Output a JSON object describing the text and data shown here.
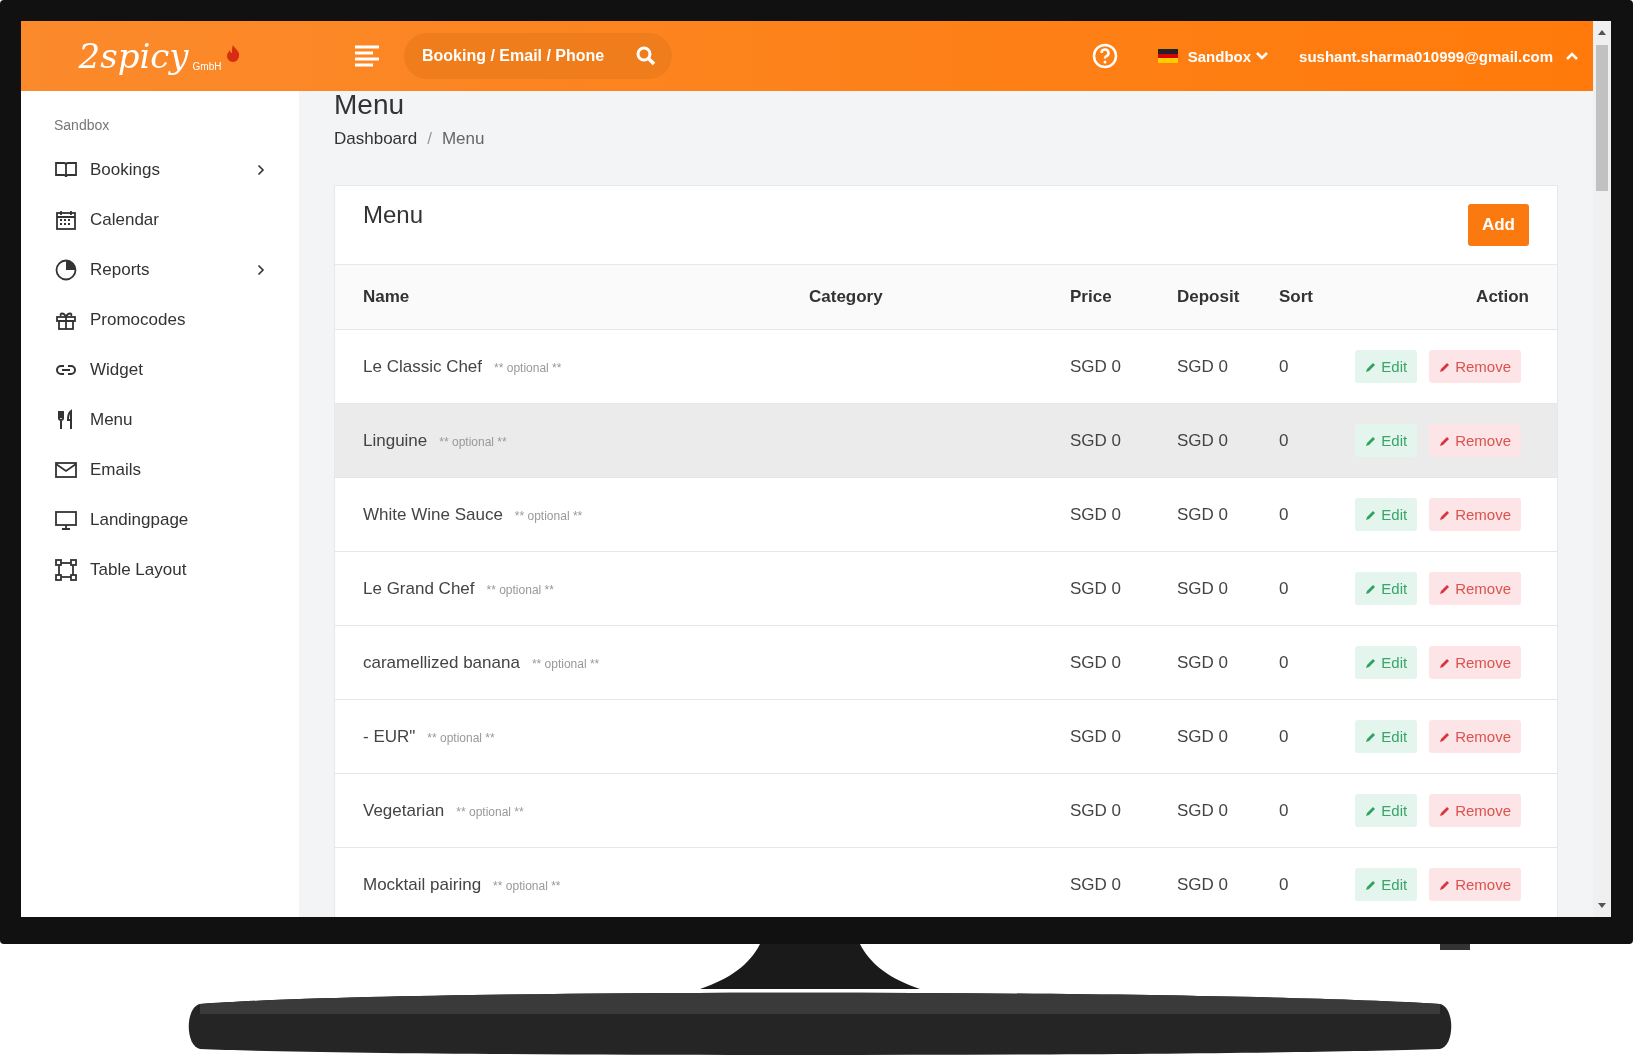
{
  "header": {
    "logo": "2spicy",
    "logo_sub": "GmbH",
    "search": {
      "placeholder": "Booking / Email / Phone"
    },
    "workspace": "Sandbox",
    "user": "sushant.sharma010999@gmail.com"
  },
  "sidebar": {
    "section": "Sandbox",
    "items": [
      {
        "label": "Bookings",
        "kind": "book",
        "has_submenu": true
      },
      {
        "label": "Calendar",
        "kind": "calendar",
        "has_submenu": false
      },
      {
        "label": "Reports",
        "kind": "pie",
        "has_submenu": true
      },
      {
        "label": "Promocodes",
        "kind": "gift",
        "has_submenu": false
      },
      {
        "label": "Widget",
        "kind": "link",
        "has_submenu": false
      },
      {
        "label": "Menu",
        "kind": "cutlery",
        "has_submenu": false
      },
      {
        "label": "Emails",
        "kind": "mail",
        "has_submenu": false
      },
      {
        "label": "Landingpage",
        "kind": "monitor",
        "has_submenu": false
      },
      {
        "label": "Table Layout",
        "kind": "layout",
        "has_submenu": false
      }
    ]
  },
  "page": {
    "title": "Menu",
    "breadcrumb": [
      "Dashboard",
      "Menu"
    ],
    "breadcrumb_separator": "/"
  },
  "card": {
    "title": "Menu",
    "add_button": "Add",
    "columns": [
      "Name",
      "Category",
      "Price",
      "Deposit",
      "Sort",
      "Action"
    ],
    "rows": [
      {
        "name": "Le Classic Chef",
        "note": "** optional **",
        "price": "SGD 0",
        "deposit": "SGD 0",
        "sort": "0",
        "edit": "Edit",
        "remove": "Remove",
        "hovered": false
      },
      {
        "name": "Linguine",
        "note": "** optional **",
        "price": "SGD 0",
        "deposit": "SGD 0",
        "sort": "0",
        "edit": "Edit",
        "remove": "Remove",
        "hovered": true
      },
      {
        "name": "White Wine Sauce",
        "note": "** optional **",
        "price": "SGD 0",
        "deposit": "SGD 0",
        "sort": "0",
        "edit": "Edit",
        "remove": "Remove",
        "hovered": false
      },
      {
        "name": "Le Grand Chef",
        "note": "** optional **",
        "price": "SGD 0",
        "deposit": "SGD 0",
        "sort": "0",
        "edit": "Edit",
        "remove": "Remove",
        "hovered": false
      },
      {
        "name": "caramellized banana",
        "note": "** optional **",
        "price": "SGD 0",
        "deposit": "SGD 0",
        "sort": "0",
        "edit": "Edit",
        "remove": "Remove",
        "hovered": false
      },
      {
        "name": "- EUR\"",
        "note": "** optional **",
        "price": "SGD 0",
        "deposit": "SGD 0",
        "sort": "0",
        "edit": "Edit",
        "remove": "Remove",
        "hovered": false
      },
      {
        "name": "Vegetarian",
        "note": "** optional **",
        "price": "SGD 0",
        "deposit": "SGD 0",
        "sort": "0",
        "edit": "Edit",
        "remove": "Remove",
        "hovered": false
      },
      {
        "name": "Mocktail pairing",
        "note": "** optional **",
        "price": "SGD 0",
        "deposit": "SGD 0",
        "sort": "0",
        "edit": "Edit",
        "remove": "Remove",
        "hovered": false
      }
    ]
  }
}
